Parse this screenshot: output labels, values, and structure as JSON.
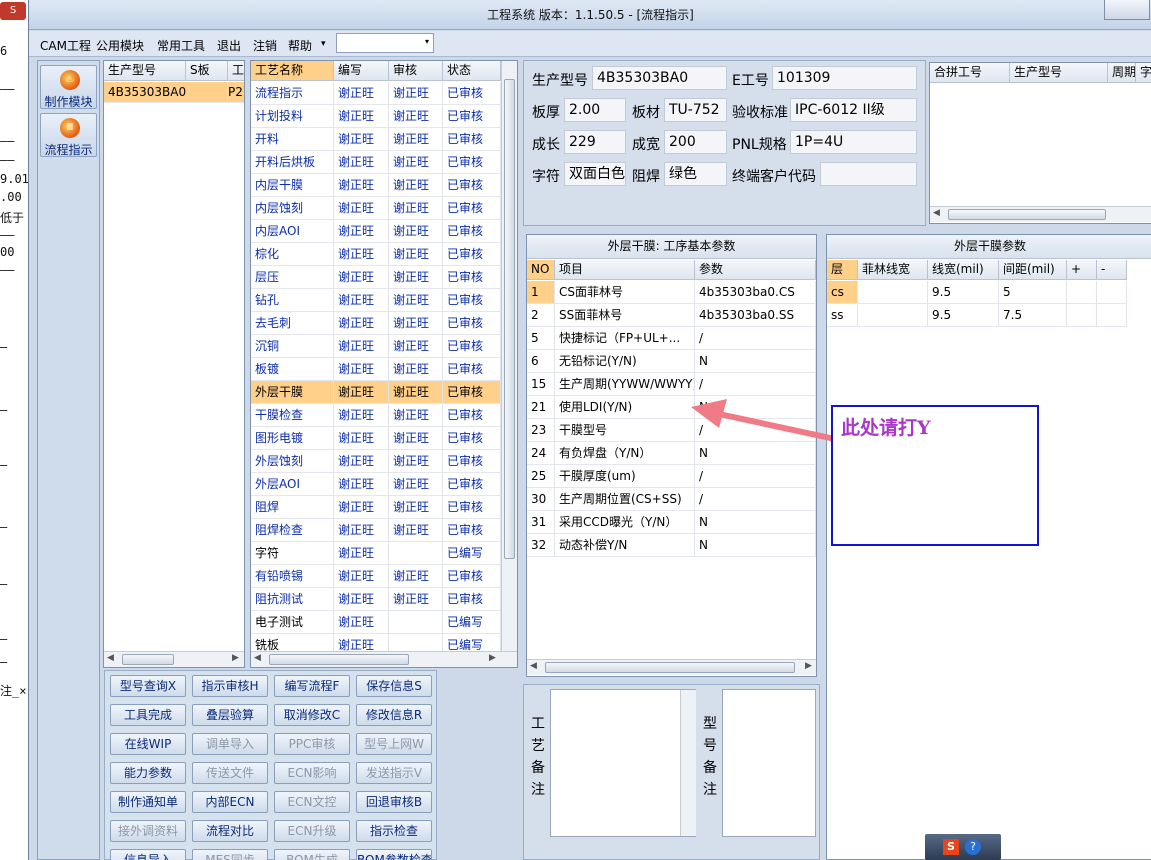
{
  "background": {
    "button_label": "S",
    "lines": [
      "6",
      "——",
      "——",
      "——",
      "9.01",
      ".00",
      "低于",
      "——",
      "00",
      "——",
      "—",
      "—",
      "—",
      "—",
      "—",
      "—",
      "—",
      "注_×"
    ]
  },
  "window": {
    "title": "工程系统    版本：1.1.50.5 - [流程指示]"
  },
  "menu": {
    "items": [
      "CAM工程",
      "公用模块",
      "常用工具",
      "退出",
      "注销",
      "帮助"
    ],
    "dropdown_arrow": "▾",
    "combo_value": ""
  },
  "nav": {
    "buttons": [
      {
        "label": "制作模块",
        "icon": "fire-icon"
      },
      {
        "label": "流程指示",
        "icon": "flow-icon"
      }
    ]
  },
  "model_grid": {
    "headers": [
      "生产型号",
      "S板",
      "工"
    ],
    "rows": [
      {
        "model": "4B35303BA0",
        "s": "",
        "g": "P2"
      }
    ]
  },
  "process_grid": {
    "headers": [
      "工艺名称",
      "编写",
      "审核",
      "状态"
    ],
    "selected_index": 13,
    "rows": [
      {
        "name": "流程指示",
        "writer": "谢正旺",
        "reviewer": "谢正旺",
        "status": "已审核"
      },
      {
        "name": "计划投料",
        "writer": "谢正旺",
        "reviewer": "谢正旺",
        "status": "已审核"
      },
      {
        "name": "开料",
        "writer": "谢正旺",
        "reviewer": "谢正旺",
        "status": "已审核"
      },
      {
        "name": "开料后烘板",
        "writer": "谢正旺",
        "reviewer": "谢正旺",
        "status": "已审核"
      },
      {
        "name": "内层干膜",
        "writer": "谢正旺",
        "reviewer": "谢正旺",
        "status": "已审核"
      },
      {
        "name": "内层蚀刻",
        "writer": "谢正旺",
        "reviewer": "谢正旺",
        "status": "已审核"
      },
      {
        "name": "内层AOI",
        "writer": "谢正旺",
        "reviewer": "谢正旺",
        "status": "已审核"
      },
      {
        "name": "棕化",
        "writer": "谢正旺",
        "reviewer": "谢正旺",
        "status": "已审核"
      },
      {
        "name": "层压",
        "writer": "谢正旺",
        "reviewer": "谢正旺",
        "status": "已审核"
      },
      {
        "name": "钻孔",
        "writer": "谢正旺",
        "reviewer": "谢正旺",
        "status": "已审核"
      },
      {
        "name": "去毛刺",
        "writer": "谢正旺",
        "reviewer": "谢正旺",
        "status": "已审核"
      },
      {
        "name": "沉铜",
        "writer": "谢正旺",
        "reviewer": "谢正旺",
        "status": "已审核"
      },
      {
        "name": "板镀",
        "writer": "谢正旺",
        "reviewer": "谢正旺",
        "status": "已审核"
      },
      {
        "name": "外层干膜",
        "writer": "谢正旺",
        "reviewer": "谢正旺",
        "status": "已审核"
      },
      {
        "name": "干膜检查",
        "writer": "谢正旺",
        "reviewer": "谢正旺",
        "status": "已审核"
      },
      {
        "name": "图形电镀",
        "writer": "谢正旺",
        "reviewer": "谢正旺",
        "status": "已审核"
      },
      {
        "name": "外层蚀刻",
        "writer": "谢正旺",
        "reviewer": "谢正旺",
        "status": "已审核"
      },
      {
        "name": "外层AOI",
        "writer": "谢正旺",
        "reviewer": "谢正旺",
        "status": "已审核"
      },
      {
        "name": "阻焊",
        "writer": "谢正旺",
        "reviewer": "谢正旺",
        "status": "已审核"
      },
      {
        "name": "阻焊检查",
        "writer": "谢正旺",
        "reviewer": "谢正旺",
        "status": "已审核"
      },
      {
        "name": "字符",
        "writer": "谢正旺",
        "reviewer": "",
        "status": "已编写"
      },
      {
        "name": "有铅喷锡",
        "writer": "谢正旺",
        "reviewer": "谢正旺",
        "status": "已审核"
      },
      {
        "name": "阻抗测试",
        "writer": "谢正旺",
        "reviewer": "谢正旺",
        "status": "已审核"
      },
      {
        "name": "电子测试",
        "writer": "谢正旺",
        "reviewer": "",
        "status": "已编写"
      },
      {
        "name": "铣板",
        "writer": "谢正旺",
        "reviewer": "",
        "status": "已编写"
      }
    ]
  },
  "action_buttons": [
    {
      "label": "型号查询X",
      "enabled": true
    },
    {
      "label": "指示审核H",
      "enabled": true
    },
    {
      "label": "编写流程F",
      "enabled": true
    },
    {
      "label": "保存信息S",
      "enabled": true
    },
    {
      "label": "工具完成",
      "enabled": true
    },
    {
      "label": "叠层验算",
      "enabled": true
    },
    {
      "label": "取消修改C",
      "enabled": true
    },
    {
      "label": "修改信息R",
      "enabled": true
    },
    {
      "label": "在线WIP",
      "enabled": true
    },
    {
      "label": "调单导入",
      "enabled": false
    },
    {
      "label": "PPC审核",
      "enabled": false
    },
    {
      "label": "型号上网W",
      "enabled": false
    },
    {
      "label": "能力参数",
      "enabled": true
    },
    {
      "label": "传送文件",
      "enabled": false
    },
    {
      "label": "ECN影响",
      "enabled": false
    },
    {
      "label": "发送指示V",
      "enabled": false
    },
    {
      "label": "制作通知单",
      "enabled": true
    },
    {
      "label": "内部ECN",
      "enabled": true
    },
    {
      "label": "ECN文控",
      "enabled": false
    },
    {
      "label": "回退审核B",
      "enabled": true
    },
    {
      "label": "接外调资料",
      "enabled": false
    },
    {
      "label": "流程对比",
      "enabled": true
    },
    {
      "label": "ECN升级",
      "enabled": false
    },
    {
      "label": "指示检查",
      "enabled": true
    },
    {
      "label": "信息导入",
      "enabled": true
    },
    {
      "label": "MES同步",
      "enabled": false
    },
    {
      "label": "BOM生成",
      "enabled": false
    },
    {
      "label": "BOM参数检查",
      "enabled": true
    }
  ],
  "info": {
    "model_label": "生产型号",
    "model_value": "4B35303BA0",
    "e_label": "E工号",
    "e_value": "101309",
    "thick_label": "板厚",
    "thick_value": "2.00",
    "material_label": "板材",
    "material_value": "TU-752",
    "standard_label": "验收标准",
    "standard_value": "IPC-6012 II级",
    "length_label": "成长",
    "length_value": "229",
    "width_label": "成宽",
    "width_value": "200",
    "pnl_label": "PNL规格",
    "pnl_value": "1P=4U",
    "char_label": "字符",
    "char_value": "双面白色",
    "mask_label": "阻焊",
    "mask_value": "绿色",
    "customer_label": "终端客户代码",
    "customer_value": ""
  },
  "merge_grid": {
    "headers": [
      "合拼工号",
      "生产型号",
      "周期",
      "字符"
    ]
  },
  "params": {
    "title": "外层干膜: 工序基本参数",
    "headers": [
      "NO",
      "项目",
      "参数"
    ],
    "selected_index": 0,
    "rows": [
      {
        "no": "1",
        "item": "CS面菲林号",
        "value": "4b35303ba0.CS"
      },
      {
        "no": "2",
        "item": "SS面菲林号",
        "value": "4b35303ba0.SS"
      },
      {
        "no": "5",
        "item": "快捷标记（FP+UL+...",
        "value": "/"
      },
      {
        "no": "6",
        "item": "无铅标记(Y/N)",
        "value": "N"
      },
      {
        "no": "15",
        "item": "生产周期(YYWW/WWYY)",
        "value": "/"
      },
      {
        "no": "21",
        "item": "使用LDI(Y/N)",
        "value": "N"
      },
      {
        "no": "23",
        "item": "干膜型号",
        "value": "/"
      },
      {
        "no": "24",
        "item": "有负焊盘（Y/N）",
        "value": "N"
      },
      {
        "no": "25",
        "item": "干膜厚度(um)",
        "value": "/"
      },
      {
        "no": "30",
        "item": "生产周期位置(CS+SS)",
        "value": "/"
      },
      {
        "no": "31",
        "item": "采用CCD曝光（Y/N）",
        "value": "N"
      },
      {
        "no": "32",
        "item": "动态补偿Y/N",
        "value": "N"
      }
    ]
  },
  "film": {
    "title": "外层干膜参数",
    "headers": [
      "层",
      "菲林线宽",
      "线宽(mil)",
      "间距(mil)",
      "+",
      "-"
    ],
    "rows": [
      {
        "layer": "cs",
        "film_width": "",
        "width": "9.5",
        "space": "5"
      },
      {
        "layer": "ss",
        "film_width": "",
        "width": "9.5",
        "space": "7.5"
      }
    ]
  },
  "annotation": {
    "text": "此处请打Y",
    "arrow_color": "#f07a86",
    "box_color": "#1414c8",
    "text_color": "#a836c8"
  },
  "remarks": {
    "process_label": "工艺备注",
    "model_label": "型号备注"
  },
  "taskbar": {
    "s_label": "S",
    "help_label": "?"
  }
}
